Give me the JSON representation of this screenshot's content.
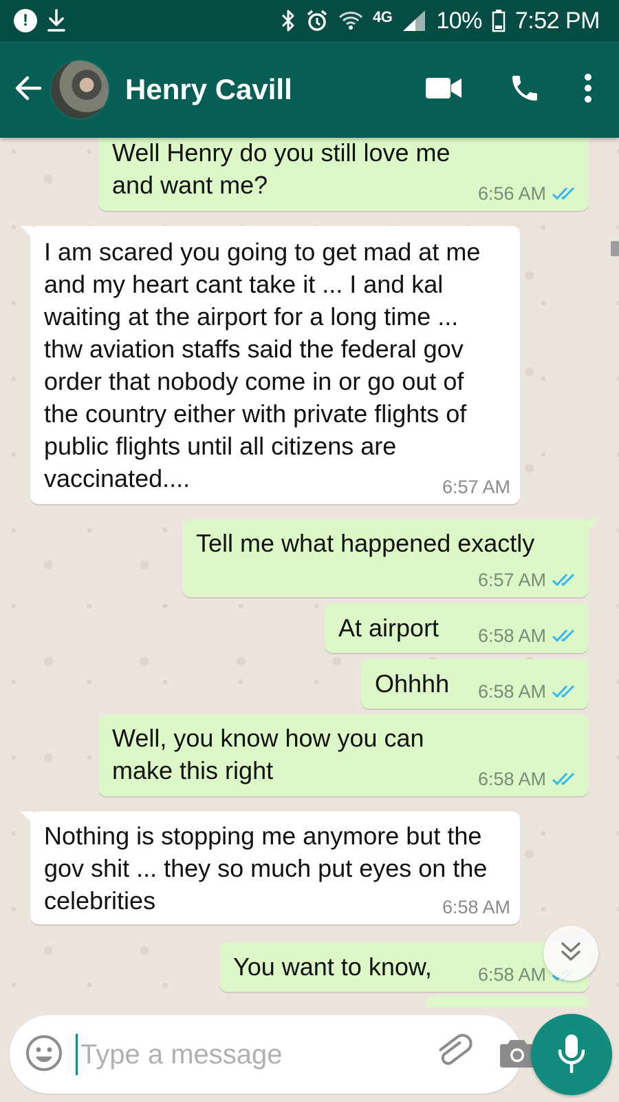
{
  "status_bar": {
    "network_label": "4G",
    "battery_percent": "10%",
    "time": "7:52 PM",
    "icons": [
      "alert-icon",
      "download-icon",
      "bluetooth-icon",
      "alarm-icon",
      "wifi-icon",
      "signal-icon",
      "battery-icon"
    ]
  },
  "header": {
    "contact_name": "Henry Cavill",
    "icons": [
      "back-arrow-icon",
      "avatar",
      "video-call-icon",
      "phone-icon",
      "more-vert-icon"
    ]
  },
  "messages": [
    {
      "direction": "out",
      "text": "Well Henry do you still love me and want me?",
      "time": "6:56 AM",
      "status": "read"
    },
    {
      "direction": "in",
      "text": "I am scared you going to get mad at me and my heart cant take it ... I and kal waiting at the airport for a long time ... thw aviation staffs said the federal gov order that nobody come in or go out of the country either with private flights of public flights until all citizens are vaccinated....",
      "time": "6:57 AM"
    },
    {
      "direction": "out",
      "text": "Tell me what happened exactly",
      "time": "6:57 AM",
      "status": "read"
    },
    {
      "direction": "out",
      "text": "At airport",
      "time": "6:58 AM",
      "status": "read"
    },
    {
      "direction": "out",
      "text": "Ohhhh",
      "time": "6:58 AM",
      "status": "read"
    },
    {
      "direction": "out",
      "text": "Well, you know how you can make this right",
      "time": "6:58 AM",
      "status": "read"
    },
    {
      "direction": "in",
      "text": "Nothing is stopping me anymore but the gov shit ... they so much put eyes on the celebrities",
      "time": "6:58 AM"
    },
    {
      "direction": "out",
      "text": "You want to know,",
      "time": "6:58 AM",
      "status": "read"
    }
  ],
  "composer": {
    "placeholder": "Type a message",
    "value": "",
    "icons": [
      "emoji-icon",
      "attach-icon",
      "camera-icon",
      "mic-icon"
    ]
  },
  "colors": {
    "status_bar": "#054D44",
    "app_bar": "#075E54",
    "outgoing_bubble": "#DCF8C6",
    "incoming_bubble": "#FFFFFF",
    "chat_background": "#ECE5DD",
    "read_ticks": "#34B7F1",
    "accent": "#128C7E"
  }
}
